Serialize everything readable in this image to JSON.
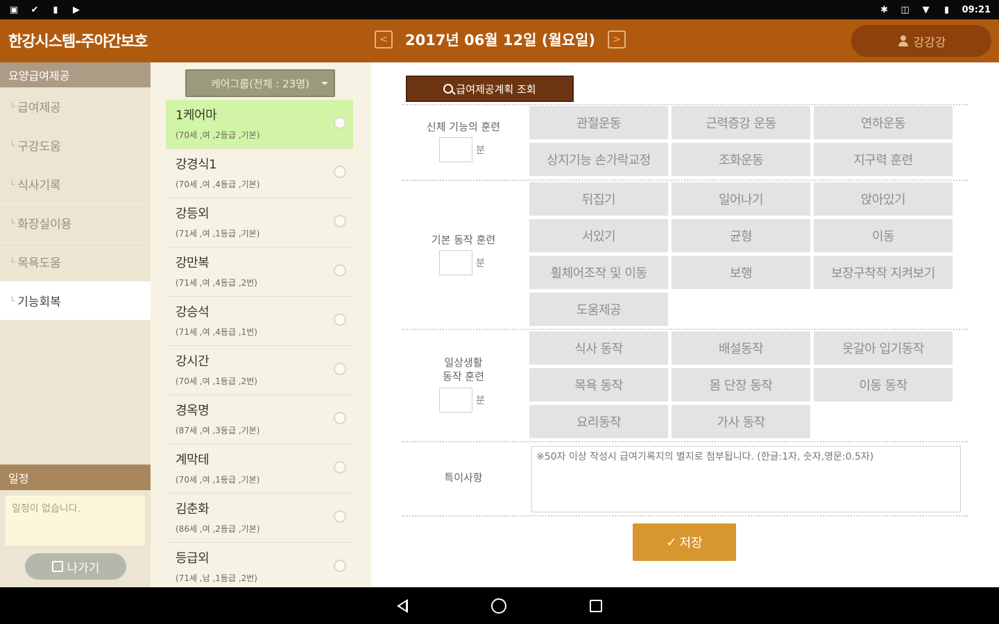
{
  "status": {
    "time": "09:21"
  },
  "header": {
    "title": "한강시스템-주야간보호",
    "date": "2017년 06월 12일 (월요일)",
    "prev": "<",
    "next": ">",
    "user": "강강강"
  },
  "sidebar": {
    "section_title": "요양급여제공",
    "items": [
      {
        "label": "급여제공",
        "active": false
      },
      {
        "label": "구강도움",
        "active": false
      },
      {
        "label": "식사기록",
        "active": false
      },
      {
        "label": "화장실이용",
        "active": false
      },
      {
        "label": "목욕도움",
        "active": false
      },
      {
        "label": "기능회복",
        "active": true
      }
    ],
    "schedule_title": "일정",
    "schedule_empty": "일정이 없습니다.",
    "exit_label": "나가기"
  },
  "patients": {
    "group_label": "케어그룹(전체 : 23명)",
    "rows": [
      {
        "name": "1케어마",
        "info": "(70세 ,여 ,2등급 ,기본)"
      },
      {
        "name": "강경식1",
        "info": "(70세 ,여 ,4등급 ,기본)"
      },
      {
        "name": "강등외",
        "info": "(71세 ,여 ,1등급 ,기본)"
      },
      {
        "name": "강만복",
        "info": "(71세 ,여 ,4등급 ,2번)"
      },
      {
        "name": "강승석",
        "info": "(71세 ,여 ,4등급 ,1번)"
      },
      {
        "name": "강시간",
        "info": "(70세 ,여 ,1등급 ,2번)"
      },
      {
        "name": "경옥명",
        "info": "(87세 ,여 ,3등급 ,기본)"
      },
      {
        "name": "계막테",
        "info": "(70세 ,여 ,1등급 ,기본)"
      },
      {
        "name": "김춘화",
        "info": "(86세 ,여 ,2등급 ,기본)"
      },
      {
        "name": "등급외",
        "info": "(71세 ,남 ,1등급 ,2번)"
      }
    ]
  },
  "main": {
    "query_label": "급여제공계획 조회",
    "minute_unit": "분",
    "sections": [
      {
        "label": "신체 기능의 훈련",
        "options": [
          "관절운동",
          "근력증강 운동",
          "연하운동",
          "상지기능 손가락교정",
          "조화운동",
          "지구력 훈련"
        ]
      },
      {
        "label": "기본 동작 훈련",
        "options": [
          "뒤집기",
          "일어나기",
          "앉아있기",
          "서있기",
          "균형",
          "이동",
          "휠체어조작 및 이동",
          "보행",
          "보장구착작 지켜보기",
          "도움제공"
        ]
      },
      {
        "label": "일상생활 동작 훈련",
        "label_line1": "일상생활",
        "label_line2": "동작 훈련",
        "options": [
          "식사 동작",
          "배설동작",
          "옷갈아 입기동작",
          "목욕 동작",
          "몸 단장 동작",
          "이동 동작",
          "요리동작",
          "가사 동작"
        ]
      }
    ],
    "notes_label": "특이사항",
    "notes_placeholder": "※50자 이상 작성시 급여기록지의 별지로 첨부됩니다. (한글:1자, 숫자,영문:0.5자)",
    "save_label": "저장"
  },
  "colors": {
    "header": "#b05a10",
    "selected_row": "#d2f4a6",
    "save": "#d8962e",
    "query": "#6e3512"
  }
}
